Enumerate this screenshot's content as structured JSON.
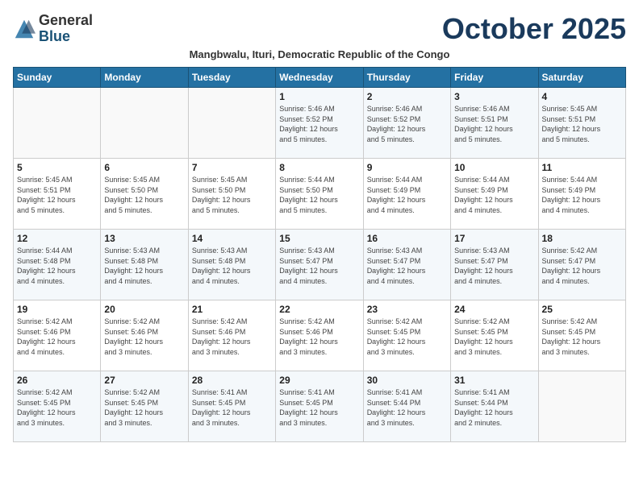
{
  "header": {
    "logo_general": "General",
    "logo_blue": "Blue",
    "month_title": "October 2025",
    "subtitle": "Mangbwalu, Ituri, Democratic Republic of the Congo"
  },
  "weekdays": [
    "Sunday",
    "Monday",
    "Tuesday",
    "Wednesday",
    "Thursday",
    "Friday",
    "Saturday"
  ],
  "weeks": [
    [
      {
        "day": "",
        "lines": []
      },
      {
        "day": "",
        "lines": []
      },
      {
        "day": "",
        "lines": []
      },
      {
        "day": "1",
        "lines": [
          "Sunrise: 5:46 AM",
          "Sunset: 5:52 PM",
          "Daylight: 12 hours",
          "and 5 minutes."
        ]
      },
      {
        "day": "2",
        "lines": [
          "Sunrise: 5:46 AM",
          "Sunset: 5:52 PM",
          "Daylight: 12 hours",
          "and 5 minutes."
        ]
      },
      {
        "day": "3",
        "lines": [
          "Sunrise: 5:46 AM",
          "Sunset: 5:51 PM",
          "Daylight: 12 hours",
          "and 5 minutes."
        ]
      },
      {
        "day": "4",
        "lines": [
          "Sunrise: 5:45 AM",
          "Sunset: 5:51 PM",
          "Daylight: 12 hours",
          "and 5 minutes."
        ]
      }
    ],
    [
      {
        "day": "5",
        "lines": [
          "Sunrise: 5:45 AM",
          "Sunset: 5:51 PM",
          "Daylight: 12 hours",
          "and 5 minutes."
        ]
      },
      {
        "day": "6",
        "lines": [
          "Sunrise: 5:45 AM",
          "Sunset: 5:50 PM",
          "Daylight: 12 hours",
          "and 5 minutes."
        ]
      },
      {
        "day": "7",
        "lines": [
          "Sunrise: 5:45 AM",
          "Sunset: 5:50 PM",
          "Daylight: 12 hours",
          "and 5 minutes."
        ]
      },
      {
        "day": "8",
        "lines": [
          "Sunrise: 5:44 AM",
          "Sunset: 5:50 PM",
          "Daylight: 12 hours",
          "and 5 minutes."
        ]
      },
      {
        "day": "9",
        "lines": [
          "Sunrise: 5:44 AM",
          "Sunset: 5:49 PM",
          "Daylight: 12 hours",
          "and 4 minutes."
        ]
      },
      {
        "day": "10",
        "lines": [
          "Sunrise: 5:44 AM",
          "Sunset: 5:49 PM",
          "Daylight: 12 hours",
          "and 4 minutes."
        ]
      },
      {
        "day": "11",
        "lines": [
          "Sunrise: 5:44 AM",
          "Sunset: 5:49 PM",
          "Daylight: 12 hours",
          "and 4 minutes."
        ]
      }
    ],
    [
      {
        "day": "12",
        "lines": [
          "Sunrise: 5:44 AM",
          "Sunset: 5:48 PM",
          "Daylight: 12 hours",
          "and 4 minutes."
        ]
      },
      {
        "day": "13",
        "lines": [
          "Sunrise: 5:43 AM",
          "Sunset: 5:48 PM",
          "Daylight: 12 hours",
          "and 4 minutes."
        ]
      },
      {
        "day": "14",
        "lines": [
          "Sunrise: 5:43 AM",
          "Sunset: 5:48 PM",
          "Daylight: 12 hours",
          "and 4 minutes."
        ]
      },
      {
        "day": "15",
        "lines": [
          "Sunrise: 5:43 AM",
          "Sunset: 5:47 PM",
          "Daylight: 12 hours",
          "and 4 minutes."
        ]
      },
      {
        "day": "16",
        "lines": [
          "Sunrise: 5:43 AM",
          "Sunset: 5:47 PM",
          "Daylight: 12 hours",
          "and 4 minutes."
        ]
      },
      {
        "day": "17",
        "lines": [
          "Sunrise: 5:43 AM",
          "Sunset: 5:47 PM",
          "Daylight: 12 hours",
          "and 4 minutes."
        ]
      },
      {
        "day": "18",
        "lines": [
          "Sunrise: 5:42 AM",
          "Sunset: 5:47 PM",
          "Daylight: 12 hours",
          "and 4 minutes."
        ]
      }
    ],
    [
      {
        "day": "19",
        "lines": [
          "Sunrise: 5:42 AM",
          "Sunset: 5:46 PM",
          "Daylight: 12 hours",
          "and 4 minutes."
        ]
      },
      {
        "day": "20",
        "lines": [
          "Sunrise: 5:42 AM",
          "Sunset: 5:46 PM",
          "Daylight: 12 hours",
          "and 3 minutes."
        ]
      },
      {
        "day": "21",
        "lines": [
          "Sunrise: 5:42 AM",
          "Sunset: 5:46 PM",
          "Daylight: 12 hours",
          "and 3 minutes."
        ]
      },
      {
        "day": "22",
        "lines": [
          "Sunrise: 5:42 AM",
          "Sunset: 5:46 PM",
          "Daylight: 12 hours",
          "and 3 minutes."
        ]
      },
      {
        "day": "23",
        "lines": [
          "Sunrise: 5:42 AM",
          "Sunset: 5:45 PM",
          "Daylight: 12 hours",
          "and 3 minutes."
        ]
      },
      {
        "day": "24",
        "lines": [
          "Sunrise: 5:42 AM",
          "Sunset: 5:45 PM",
          "Daylight: 12 hours",
          "and 3 minutes."
        ]
      },
      {
        "day": "25",
        "lines": [
          "Sunrise: 5:42 AM",
          "Sunset: 5:45 PM",
          "Daylight: 12 hours",
          "and 3 minutes."
        ]
      }
    ],
    [
      {
        "day": "26",
        "lines": [
          "Sunrise: 5:42 AM",
          "Sunset: 5:45 PM",
          "Daylight: 12 hours",
          "and 3 minutes."
        ]
      },
      {
        "day": "27",
        "lines": [
          "Sunrise: 5:42 AM",
          "Sunset: 5:45 PM",
          "Daylight: 12 hours",
          "and 3 minutes."
        ]
      },
      {
        "day": "28",
        "lines": [
          "Sunrise: 5:41 AM",
          "Sunset: 5:45 PM",
          "Daylight: 12 hours",
          "and 3 minutes."
        ]
      },
      {
        "day": "29",
        "lines": [
          "Sunrise: 5:41 AM",
          "Sunset: 5:45 PM",
          "Daylight: 12 hours",
          "and 3 minutes."
        ]
      },
      {
        "day": "30",
        "lines": [
          "Sunrise: 5:41 AM",
          "Sunset: 5:44 PM",
          "Daylight: 12 hours",
          "and 3 minutes."
        ]
      },
      {
        "day": "31",
        "lines": [
          "Sunrise: 5:41 AM",
          "Sunset: 5:44 PM",
          "Daylight: 12 hours",
          "and 2 minutes."
        ]
      },
      {
        "day": "",
        "lines": []
      }
    ]
  ]
}
